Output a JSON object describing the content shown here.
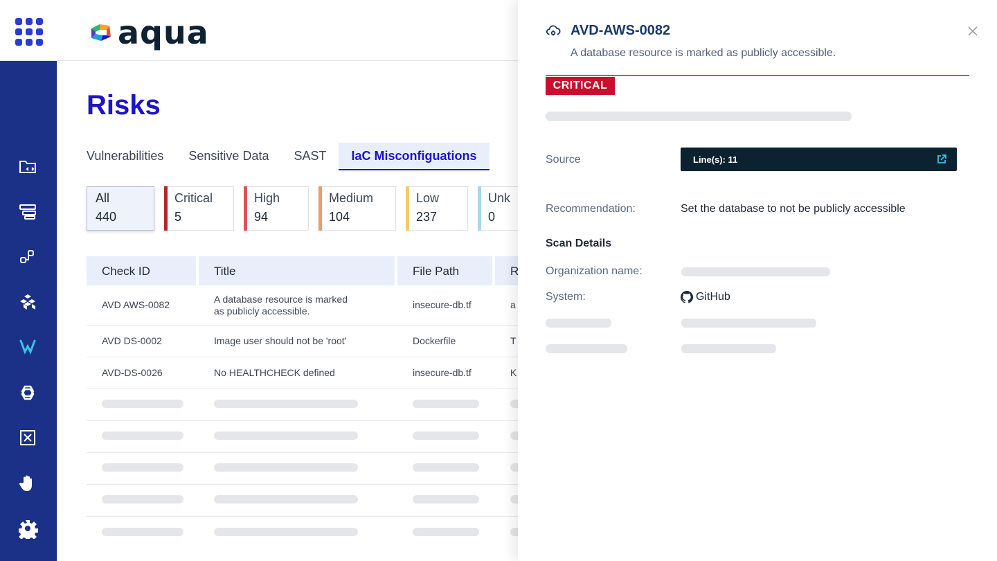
{
  "brand": {
    "logo_text": "aqua",
    "accent": "#1d13c9",
    "sidebar_bg": "#1b3087"
  },
  "page": {
    "title": "Risks",
    "tabs": [
      {
        "label": "Vulnerabilities",
        "active": false
      },
      {
        "label": "Sensitive Data",
        "active": false
      },
      {
        "label": "SAST",
        "active": false
      },
      {
        "label": "IaC Misconfiguations",
        "active": true
      }
    ]
  },
  "severity_cards": [
    {
      "label": "All",
      "count": "440",
      "color": ""
    },
    {
      "label": "Critical",
      "count": "5",
      "color": "#b3262e"
    },
    {
      "label": "High",
      "count": "94",
      "color": "#e0515a"
    },
    {
      "label": "Medium",
      "count": "104",
      "color": "#f09a6b"
    },
    {
      "label": "Low",
      "count": "237",
      "color": "#f5c96a"
    },
    {
      "label": "Unk",
      "count": "0",
      "color": "#a8d8ea"
    }
  ],
  "table": {
    "columns": [
      "Check ID",
      "Title",
      "File Path",
      "R"
    ],
    "rows": [
      {
        "check_id": "AVD AWS-0082",
        "title_line1": "A database resource is marked",
        "title_line2": "as publicly accessible.",
        "file_path": "insecure-db.tf",
        "r": "a"
      },
      {
        "check_id": "AVD DS-0002",
        "title_line1": "Image user should not be 'root'",
        "title_line2": "",
        "file_path": "Dockerfile",
        "r": "T"
      },
      {
        "check_id": "AVD-DS-0026",
        "title_line1": "No HEALTHCHECK defined",
        "title_line2": "",
        "file_path": "insecure-db.tf",
        "r": "K"
      }
    ]
  },
  "sidebar": {
    "items": [
      {
        "icon": "folder-code-icon"
      },
      {
        "icon": "layers-icon"
      },
      {
        "icon": "pipeline-icon"
      },
      {
        "icon": "cubes-icon"
      },
      {
        "icon": "aqua-shield-icon",
        "active": true
      },
      {
        "icon": "link-hexagon-icon"
      },
      {
        "icon": "policy-box-icon"
      },
      {
        "icon": "hand-stop-icon"
      },
      {
        "icon": "settings-puzzle-icon"
      }
    ]
  },
  "drawer": {
    "check_id": "AVD-AWS-0082",
    "description": "A database resource is marked as publicly accessible.",
    "severity": "CRITICAL",
    "severity_color": "#c8102e",
    "source_label": "Source",
    "source_value": "Line(s): 11",
    "recommendation_label": "Recommendation:",
    "recommendation_value": "Set the database to not be publicly accessible",
    "scan_details_title": "Scan Details",
    "org_label": "Organization name:",
    "system_label": "System:",
    "system_value": "GitHub"
  }
}
